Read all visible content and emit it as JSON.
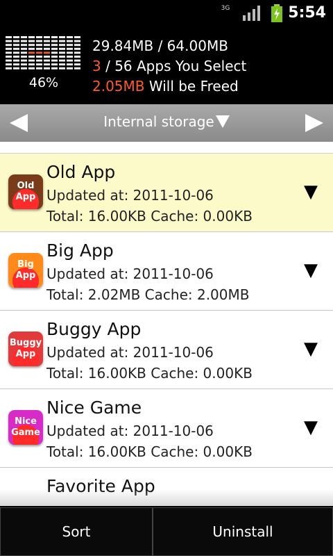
{
  "status": {
    "network": "3G",
    "time": "5:54"
  },
  "memory": {
    "percent": "46%",
    "usage": "29.84MB / 64.00MB",
    "selected_count": "3",
    "selected_rest": " / 56 Apps You Select",
    "freed_amount": "2.05MB",
    "freed_rest": " Will be Freed"
  },
  "storage": {
    "title": "Internal storage"
  },
  "apps": [
    {
      "name": "Old App",
      "updated": "Updated at: 2011-10-06",
      "total": "Total: 16.00KB Cache: 0.00KB",
      "icon_text": "Old\nApp",
      "icon_color": "#7a3b1a",
      "selected": true
    },
    {
      "name": "Big App",
      "updated": "Updated at: 2011-10-06",
      "total": "Total: 2.02MB Cache: 2.00MB",
      "icon_text": "Big\nApp",
      "icon_color": "#ff8a1a",
      "selected": false
    },
    {
      "name": "Buggy App",
      "updated": "Updated at: 2011-10-06",
      "total": "Total: 16.00KB Cache: 0.00KB",
      "icon_text": "Buggy\nApp",
      "icon_color": "#e23a3a",
      "selected": false
    },
    {
      "name": "Nice Game",
      "updated": "Updated at: 2011-10-06",
      "total": "Total: 16.00KB Cache: 0.00KB",
      "icon_text": "Nice\nGame",
      "icon_color": "#d62bc7",
      "selected": false
    },
    {
      "name": "Favorite App"
    }
  ],
  "footer": {
    "sort": "Sort",
    "uninstall": "Uninstall"
  },
  "colors": {
    "accent_red": "#ff5a2a",
    "selected_row": "#fdfac9"
  },
  "icons": [
    "3g-icon",
    "signal-icon",
    "battery-charging-icon",
    "left-arrow-icon",
    "right-arrow-icon",
    "dropdown-triangle-icon",
    "expand-triangle-icon"
  ]
}
